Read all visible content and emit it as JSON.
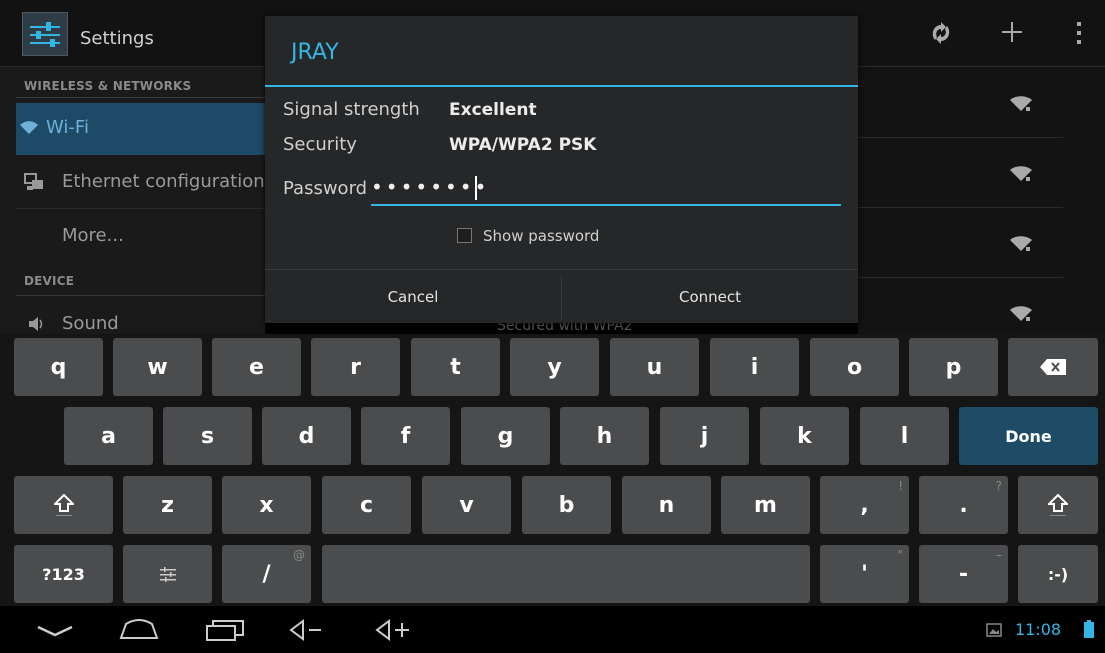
{
  "actionbar": {
    "title": "Settings",
    "icons": [
      "settings-app-icon",
      "wps-icon",
      "add-icon",
      "overflow-menu-icon"
    ]
  },
  "sidebar": {
    "sections": [
      {
        "header": "WIRELESS & NETWORKS"
      },
      {
        "header": "DEVICE"
      }
    ],
    "items": [
      {
        "label": "Wi-Fi",
        "icon": "wifi-icon",
        "active": true
      },
      {
        "label": "Ethernet configuration",
        "icon": "ethernet-icon"
      },
      {
        "label": "More..."
      },
      {
        "label": "Sound",
        "icon": "sound-icon"
      }
    ]
  },
  "background_text": "Secured with WPA2",
  "dialog": {
    "title": "JRAY",
    "signal_label": "Signal strength",
    "signal_value": "Excellent",
    "security_label": "Security",
    "security_value": "WPA/WPA2 PSK",
    "password_label": "Password",
    "password_value": "••••••••",
    "show_password_label": "Show password",
    "show_password_checked": false,
    "cancel_label": "Cancel",
    "connect_label": "Connect"
  },
  "keyboard": {
    "row1": [
      "q",
      "w",
      "e",
      "r",
      "t",
      "y",
      "u",
      "i",
      "o",
      "p"
    ],
    "row2": [
      "a",
      "s",
      "d",
      "f",
      "g",
      "h",
      "j",
      "k",
      "l"
    ],
    "row3": [
      "z",
      "x",
      "c",
      "v",
      "b",
      "n",
      "m"
    ],
    "done_label": "Done",
    "symbols_label": "?123",
    "slash_label": "/",
    "slash_hint": "@",
    "comma_label": ",",
    "comma_hint": "!",
    "period_label": ".",
    "period_hint": "?",
    "apostrophe_label": "'",
    "apostrophe_hint": "\"",
    "dash_label": "-",
    "dash_hint": "–",
    "smiley_label": ":-)"
  },
  "navbar": {
    "clock": "11:08",
    "icons": [
      "hide-keyboard-icon",
      "home-icon",
      "recent-apps-icon",
      "volume-down-icon",
      "volume-up-icon",
      "screenshot-icon",
      "battery-icon"
    ]
  },
  "colors": {
    "accent": "#33b5e5",
    "selected_bg": "#1d4a66",
    "key": "#4a4c4d"
  }
}
